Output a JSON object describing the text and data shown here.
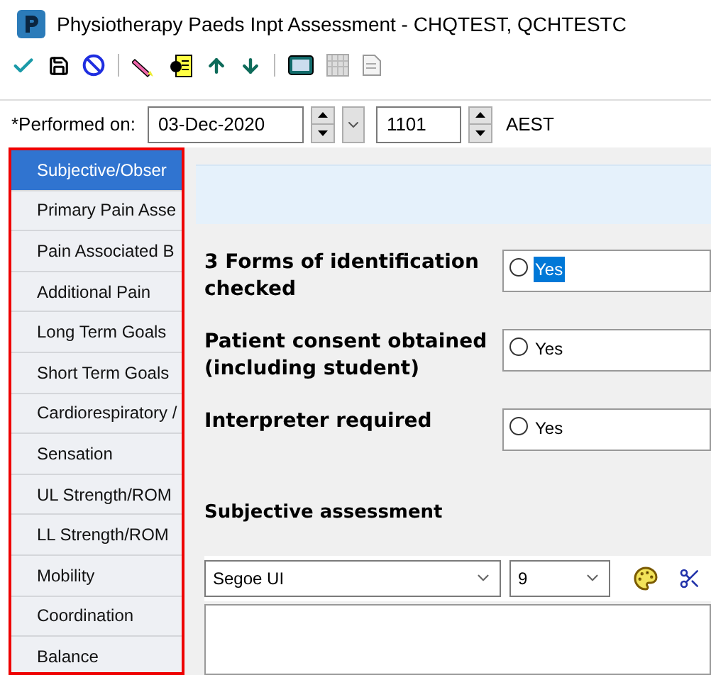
{
  "window": {
    "title": "Physiotherapy Paeds Inpt Assessment - CHQTEST, QCHTESTC"
  },
  "performed": {
    "label": "*Performed on:",
    "date": "03-Dec-2020",
    "time": "1101",
    "timezone": "AEST"
  },
  "sidebar": {
    "items": [
      {
        "label": "Subjective/Obser",
        "selected": true
      },
      {
        "label": "Primary Pain Asse",
        "selected": false
      },
      {
        "label": "Pain Associated B",
        "selected": false
      },
      {
        "label": "Additional Pain",
        "selected": false
      },
      {
        "label": "Long Term Goals",
        "selected": false
      },
      {
        "label": "Short Term Goals",
        "selected": false
      },
      {
        "label": "Cardiorespiratory /",
        "selected": false
      },
      {
        "label": "Sensation",
        "selected": false
      },
      {
        "label": "UL Strength/ROM",
        "selected": false
      },
      {
        "label": "LL Strength/ROM",
        "selected": false
      },
      {
        "label": "Mobility",
        "selected": false
      },
      {
        "label": "Coordination",
        "selected": false
      },
      {
        "label": "Balance",
        "selected": false
      }
    ]
  },
  "questions": [
    {
      "label": "3 Forms of identification checked",
      "option": "Yes",
      "checked": false,
      "highlighted": true
    },
    {
      "label": "Patient consent obtained (including student)",
      "option": "Yes",
      "checked": false,
      "highlighted": false
    },
    {
      "label": "Interpreter required",
      "option": "Yes",
      "checked": false,
      "highlighted": false
    }
  ],
  "editor": {
    "heading": "Subjective assessment",
    "font": "Segoe UI",
    "size": "9"
  }
}
